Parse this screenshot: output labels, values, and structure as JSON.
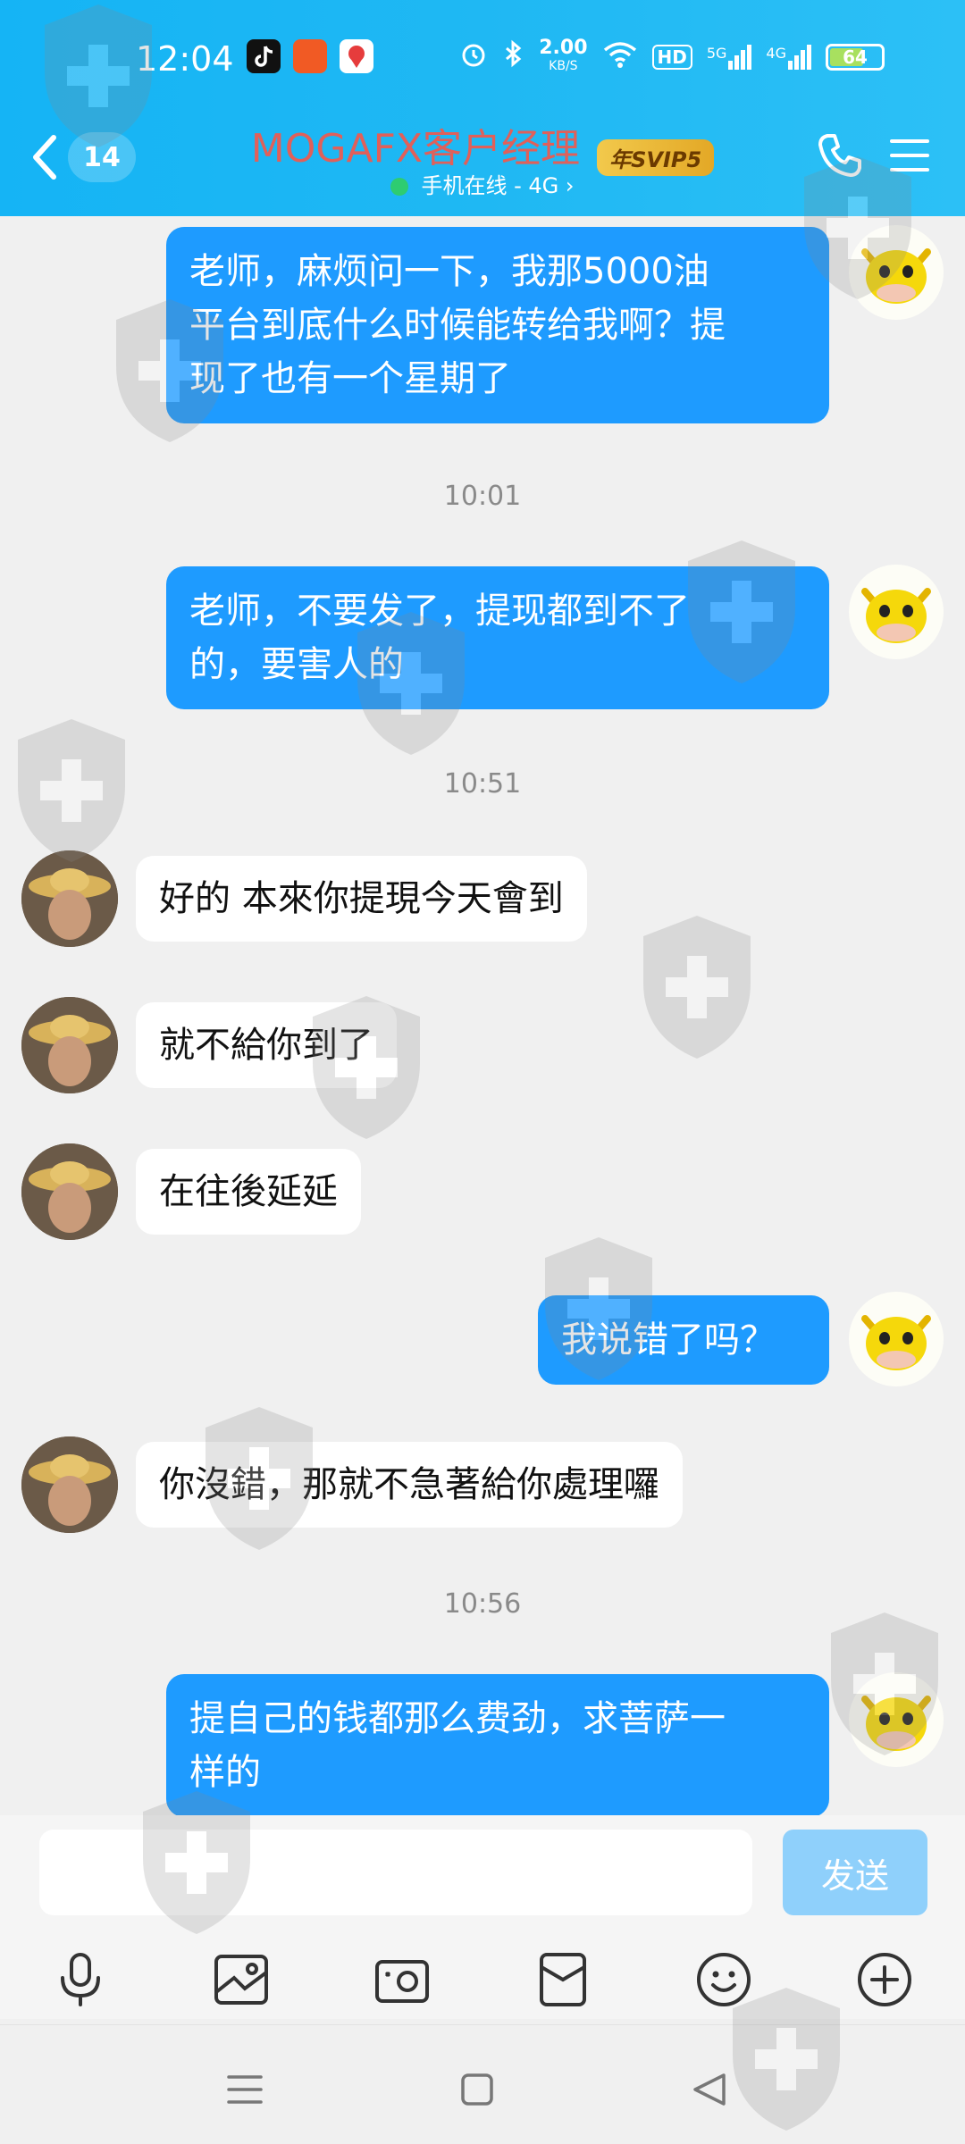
{
  "status_bar": {
    "time": "12:04",
    "speed_value": "2.00",
    "speed_unit": "KB/S",
    "hd": "HD",
    "net1": "5G",
    "net2": "4G",
    "battery": "64"
  },
  "header": {
    "back_count": "14",
    "title": "MOGAFX客户经理",
    "badge": "年SVIP5",
    "subtitle": "手机在线 - 4G ›"
  },
  "messages": [
    {
      "side": "right",
      "text_lines": [
        "老师，麻烦问一下，我那5000油",
        "平台到底什么时候能转给我啊？提",
        "现了也有一个星期了"
      ]
    },
    {
      "type": "time",
      "text": "10:01"
    },
    {
      "side": "right",
      "text_lines": [
        "老师，不要发了，提现都到不了",
        "的，要害人的"
      ]
    },
    {
      "type": "time",
      "text": "10:51"
    },
    {
      "side": "left",
      "text_lines": [
        "好的 本來你提現今天會到"
      ]
    },
    {
      "side": "left",
      "text_lines": [
        "就不給你到了"
      ]
    },
    {
      "side": "left",
      "text_lines": [
        "在往後延延"
      ]
    },
    {
      "side": "right",
      "text_lines": [
        "我说错了吗？"
      ]
    },
    {
      "side": "left",
      "text_lines": [
        "你沒錯，那就不急著給你處理囉"
      ]
    },
    {
      "type": "time",
      "text": "10:56"
    },
    {
      "side": "right",
      "text_lines": [
        "提自己的钱都那么费劲，求菩萨一",
        "样的"
      ]
    }
  ],
  "input": {
    "placeholder": "",
    "send_label": "发送"
  },
  "toolbar_icons": [
    "microphone-icon",
    "image-icon",
    "camera-icon",
    "red-packet-icon",
    "emoji-icon",
    "plus-icon"
  ],
  "nav_icons": [
    "menu-nav-icon",
    "home-nav-icon",
    "back-nav-icon"
  ],
  "colors": {
    "header": "#1fb8f3",
    "my_bubble": "#1e9bff",
    "title": "#e0605a",
    "send_disabled": "#8fd0fb"
  }
}
